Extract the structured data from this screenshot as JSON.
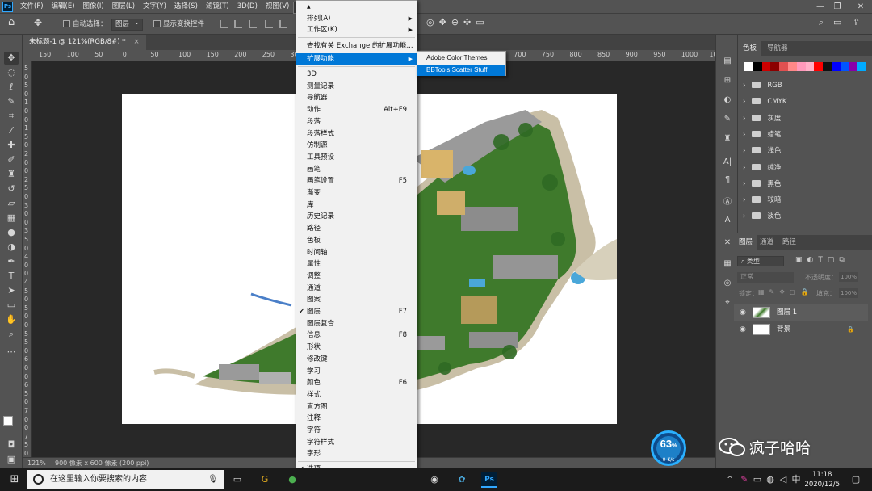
{
  "app": {
    "logo": "Ps"
  },
  "menubar": {
    "items": [
      "文件(F)",
      "编辑(E)",
      "图像(I)",
      "图层(L)",
      "文字(Y)",
      "选择(S)",
      "滤镜(T)",
      "3D(D)",
      "视图(V)",
      "窗口(W)"
    ]
  },
  "window_controls": {
    "minimize": "—",
    "restore": "❐",
    "close": "✕"
  },
  "optionsbar": {
    "auto_select_label": "自动选择：",
    "auto_select_value": "图层",
    "show_transform_label": "显示变换控件"
  },
  "document": {
    "tab_title": "未标题-1 @ 121%(RGB/8#) *",
    "close": "×"
  },
  "ruler": {
    "top_ticks": [
      "150",
      "100",
      "50",
      "0",
      "50",
      "100",
      "150",
      "200",
      "250",
      "300",
      "350",
      "400",
      "450",
      "500",
      "550",
      "600",
      "650",
      "700",
      "750",
      "800",
      "850",
      "900",
      "950",
      "1000",
      "10"
    ],
    "left_ticks": [
      "5",
      "0",
      "5",
      "0",
      "1",
      "0",
      "0",
      "1",
      "5",
      "0",
      "2",
      "0",
      "0",
      "2",
      "5",
      "0",
      "3",
      "0",
      "0",
      "3",
      "5",
      "0",
      "4",
      "0",
      "0",
      "4",
      "5",
      "0",
      "5",
      "0",
      "0",
      "5",
      "5",
      "0",
      "6",
      "0",
      "0",
      "6",
      "5",
      "0",
      "7",
      "0",
      "0",
      "7",
      "5",
      "0"
    ]
  },
  "statusbar": {
    "zoom": "121%",
    "doc_size": "900 像素 x 600 像素 (200 ppi)"
  },
  "window_menu": {
    "top_items": [
      {
        "label": "排列(A)",
        "submenu": true
      },
      {
        "label": "工作区(K)",
        "submenu": true
      },
      {
        "label": "查找有关 Exchange 的扩展功能..."
      },
      {
        "label": "扩展功能",
        "submenu": true,
        "highlighted": true
      }
    ],
    "items": [
      {
        "label": "3D"
      },
      {
        "label": "测量记录"
      },
      {
        "label": "导航器"
      },
      {
        "label": "动作",
        "shortcut": "Alt+F9"
      },
      {
        "label": "段落"
      },
      {
        "label": "段落样式"
      },
      {
        "label": "仿制源"
      },
      {
        "label": "工具预设"
      },
      {
        "label": "画笔"
      },
      {
        "label": "画笔设置",
        "shortcut": "F5"
      },
      {
        "label": "渐变"
      },
      {
        "label": "库"
      },
      {
        "label": "历史记录"
      },
      {
        "label": "路径"
      },
      {
        "label": "色板"
      },
      {
        "label": "时间轴"
      },
      {
        "label": "属性"
      },
      {
        "label": "调整"
      },
      {
        "label": "通道"
      },
      {
        "label": "图案"
      },
      {
        "label": "图层",
        "shortcut": "F7",
        "checked": true
      },
      {
        "label": "图层复合"
      },
      {
        "label": "信息",
        "shortcut": "F8"
      },
      {
        "label": "形状"
      },
      {
        "label": "修改键"
      },
      {
        "label": "学习"
      },
      {
        "label": "颜色",
        "shortcut": "F6"
      },
      {
        "label": "样式"
      },
      {
        "label": "直方图"
      },
      {
        "label": "注释"
      },
      {
        "label": "字符"
      },
      {
        "label": "字符样式"
      },
      {
        "label": "字形"
      }
    ],
    "bottom_items": [
      {
        "label": "选项",
        "checked": true
      }
    ],
    "scroll_up": "▲",
    "scroll_down": "▼"
  },
  "extensions_submenu": {
    "items": [
      {
        "label": "Adobe Color Themes"
      },
      {
        "label": "BBTools Scatter Stuff",
        "highlighted": true
      }
    ]
  },
  "swatches_panel": {
    "tabs": [
      "色板",
      "导航器"
    ],
    "colors": [
      "#ffffff",
      "#000000",
      "#cc0000",
      "#8b0000",
      "#e05050",
      "#ff8888",
      "#ff99bb",
      "#ffb0c8",
      "#ff0000",
      "#111111",
      "#0000ff",
      "#0055ff",
      "#8800aa",
      "#00aaff"
    ],
    "groups": [
      "RGB",
      "CMYK",
      "灰度",
      "蜡笔",
      "浅色",
      "纯净",
      "黑色",
      "较暗",
      "淡色"
    ]
  },
  "layers_panel": {
    "tabs": [
      "图层",
      "通道",
      "路径"
    ],
    "filter_label": "类型",
    "blend_mode": "正常",
    "opacity_label": "不透明度：",
    "opacity_value": "100%",
    "lock_label": "锁定：",
    "fill_label": "填充：",
    "fill_value": "100%",
    "layers": [
      {
        "name": "图层 1",
        "locked": false
      },
      {
        "name": "背景",
        "locked": true
      }
    ]
  },
  "net_widget": {
    "percent": "63",
    "percent_sign": "%",
    "speed": "0 K/s"
  },
  "watermark": {
    "text": "疯子哈哈"
  },
  "taskbar": {
    "search_placeholder": "在这里输入你要搜索的内容",
    "clock_time": "11:18",
    "clock_date": "2020/12/5",
    "ime": "中",
    "tray_up": "^"
  }
}
